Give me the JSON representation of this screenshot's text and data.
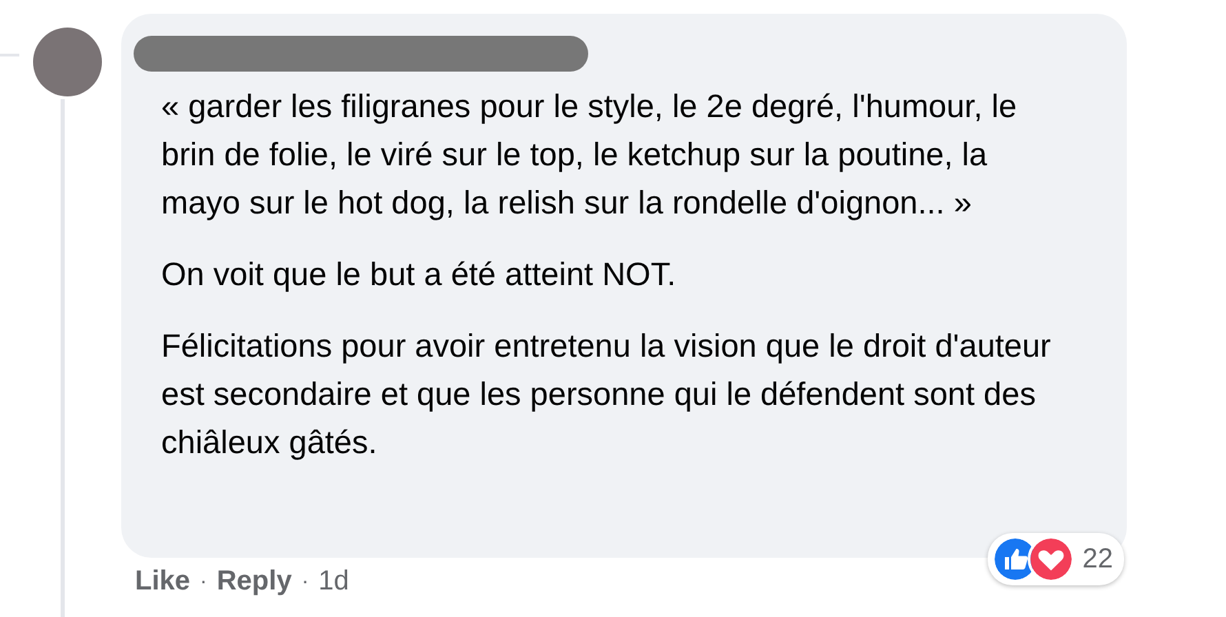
{
  "comment": {
    "paragraphs": [
      "« garder les filigranes pour le style, le 2e degré, l'humour, le brin de folie, le viré sur le top, le ketchup sur la poutine, la mayo sur le hot dog, la relish sur la rondelle d'oignon... »",
      "On voit que le but a été atteint NOT.",
      "Félicitations pour avoir entretenu la vision que le droit d'auteur est secondaire et que les personne qui le défendent sont des chiâleux gâtés."
    ],
    "actions": [
      {
        "label": "Like"
      },
      {
        "label": "Reply"
      }
    ],
    "separator": "·",
    "time": "1d",
    "reaction_count": "22"
  }
}
